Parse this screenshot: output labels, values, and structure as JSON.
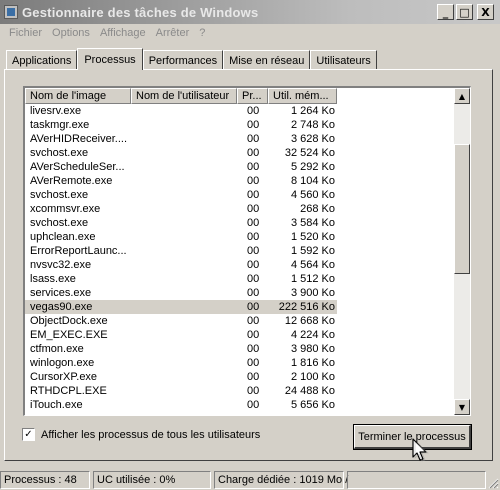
{
  "window": {
    "title": "Gestionnaire des tâches de Windows",
    "buttons": {
      "minimize": "_",
      "maximize": "□",
      "close": "X"
    }
  },
  "menu": [
    "Fichier",
    "Options",
    "Affichage",
    "Arrêter",
    "?"
  ],
  "tabs": [
    {
      "label": "Applications",
      "active": false
    },
    {
      "label": "Processus",
      "active": true
    },
    {
      "label": "Performances",
      "active": false
    },
    {
      "label": "Mise en réseau",
      "active": false
    },
    {
      "label": "Utilisateurs",
      "active": false
    }
  ],
  "columns": {
    "name": "Nom de l'image",
    "user": "Nom de l'utilisateur",
    "cpu": "Pr...",
    "mem": "Util. mém..."
  },
  "processes": [
    {
      "name": "livesrv.exe",
      "user": "",
      "cpu": "00",
      "mem": "1 264 Ko"
    },
    {
      "name": "taskmgr.exe",
      "user": "",
      "cpu": "00",
      "mem": "2 748 Ko"
    },
    {
      "name": "AVerHIDReceiver....",
      "user": "",
      "cpu": "00",
      "mem": "3 628 Ko"
    },
    {
      "name": "svchost.exe",
      "user": "",
      "cpu": "00",
      "mem": "32 524 Ko"
    },
    {
      "name": "AVerScheduleSer...",
      "user": "",
      "cpu": "00",
      "mem": "5 292 Ko"
    },
    {
      "name": "AVerRemote.exe",
      "user": "",
      "cpu": "00",
      "mem": "8 104 Ko"
    },
    {
      "name": "svchost.exe",
      "user": "",
      "cpu": "00",
      "mem": "4 560 Ko"
    },
    {
      "name": "xcommsvr.exe",
      "user": "",
      "cpu": "00",
      "mem": "268 Ko"
    },
    {
      "name": "svchost.exe",
      "user": "",
      "cpu": "00",
      "mem": "3 584 Ko"
    },
    {
      "name": "uphclean.exe",
      "user": "",
      "cpu": "00",
      "mem": "1 520 Ko"
    },
    {
      "name": "ErrorReportLaunc...",
      "user": "",
      "cpu": "00",
      "mem": "1 592 Ko"
    },
    {
      "name": "nvsvc32.exe",
      "user": "",
      "cpu": "00",
      "mem": "4 564 Ko"
    },
    {
      "name": "lsass.exe",
      "user": "",
      "cpu": "00",
      "mem": "1 512 Ko"
    },
    {
      "name": "services.exe",
      "user": "",
      "cpu": "00",
      "mem": "3 900 Ko"
    },
    {
      "name": "vegas90.exe",
      "user": "",
      "cpu": "00",
      "mem": "222 516 Ko",
      "selected": true
    },
    {
      "name": "ObjectDock.exe",
      "user": "",
      "cpu": "00",
      "mem": "12 668 Ko"
    },
    {
      "name": "EM_EXEC.EXE",
      "user": "",
      "cpu": "00",
      "mem": "4 224 Ko"
    },
    {
      "name": "ctfmon.exe",
      "user": "",
      "cpu": "00",
      "mem": "3 980 Ko"
    },
    {
      "name": "winlogon.exe",
      "user": "",
      "cpu": "00",
      "mem": "1 816 Ko"
    },
    {
      "name": "CursorXP.exe",
      "user": "",
      "cpu": "00",
      "mem": "2 100 Ko"
    },
    {
      "name": "RTHDCPL.EXE",
      "user": "",
      "cpu": "00",
      "mem": "24 488 Ko"
    },
    {
      "name": "iTouch.exe",
      "user": "",
      "cpu": "00",
      "mem": "5 656 Ko"
    }
  ],
  "scrollbar": {
    "up_arrow": "▲",
    "down_arrow": "▼"
  },
  "show_all_users": {
    "label": "Afficher les processus de tous les utilisateurs",
    "checked": true,
    "mark": "✓"
  },
  "end_process_button": "Terminer le processus",
  "status": {
    "processes": "Processus : 48",
    "cpu": "UC utilisée : 0%",
    "commit": "Charge dédiée : 1019 Mo /"
  }
}
